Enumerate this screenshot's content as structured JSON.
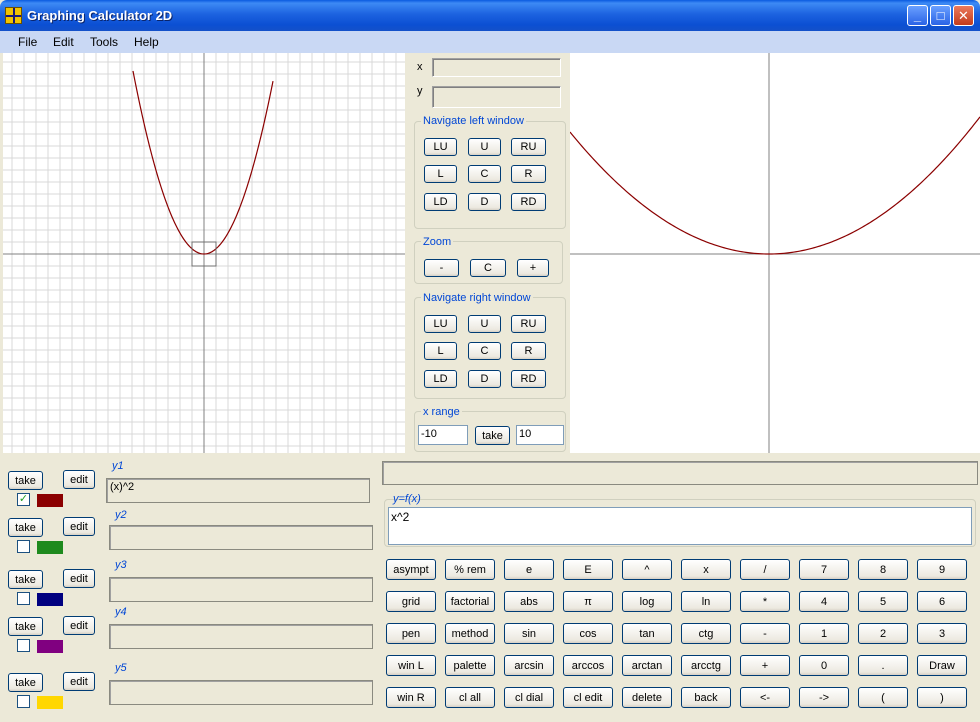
{
  "window": {
    "title": "Graphing Calculator  2D",
    "minimize": "_",
    "maximize": "□",
    "close": "✕"
  },
  "menu": [
    "File",
    "Edit",
    "Tools",
    "Help"
  ],
  "coords": {
    "x_label": "x",
    "y_label": "y",
    "x_value": "",
    "y_value": ""
  },
  "nav_left": {
    "title": "Navigate left window",
    "buttons": [
      "LU",
      "U",
      "RU",
      "L",
      "C",
      "R",
      "LD",
      "D",
      "RD"
    ]
  },
  "zoom": {
    "title": "Zoom",
    "buttons": [
      "-",
      "C",
      "+"
    ]
  },
  "nav_right": {
    "title": "Navigate right window",
    "buttons": [
      "LU",
      "U",
      "RU",
      "L",
      "C",
      "R",
      "LD",
      "D",
      "RD"
    ]
  },
  "x_range": {
    "title": "x range",
    "min": "-10",
    "take": "take",
    "max": "10"
  },
  "functions": [
    {
      "label": "y1",
      "value": "(x)^2",
      "checked": true,
      "color": "#8b0000",
      "take": "take",
      "edit": "edit"
    },
    {
      "label": "y2",
      "value": "",
      "checked": false,
      "color": "#1e8a1e",
      "take": "take",
      "edit": "edit"
    },
    {
      "label": "y3",
      "value": "",
      "checked": false,
      "color": "#000080",
      "take": "take",
      "edit": "edit"
    },
    {
      "label": "y4",
      "value": "",
      "checked": false,
      "color": "#800080",
      "take": "take",
      "edit": "edit"
    },
    {
      "label": "y5",
      "value": "",
      "checked": false,
      "color": "#ffd700",
      "take": "take",
      "edit": "edit"
    }
  ],
  "status": "",
  "editor": {
    "label": "y=f(x)",
    "value": "x^2"
  },
  "keypad": [
    [
      "asympt",
      "% rem",
      "e",
      "E",
      "^",
      "x",
      "/",
      "7",
      "8",
      "9"
    ],
    [
      "grid",
      "factorial",
      "abs",
      "π",
      "log",
      "ln",
      "*",
      "4",
      "5",
      "6"
    ],
    [
      "pen",
      "method",
      "sin",
      "cos",
      "tan",
      "ctg",
      "-",
      "1",
      "2",
      "3"
    ],
    [
      "win L",
      "palette",
      "arcsin",
      "arccos",
      "arctan",
      "arcctg",
      "+",
      "0",
      ".",
      "Draw"
    ],
    [
      "win R",
      "cl all",
      "cl dial",
      "cl edit",
      "delete",
      "back",
      "<-",
      "->",
      "(",
      ")"
    ]
  ],
  "colors": {
    "curve": "#8b0000",
    "grid": "#d8d8d8",
    "axis": "#808080",
    "title_blue": "#0046d5"
  }
}
